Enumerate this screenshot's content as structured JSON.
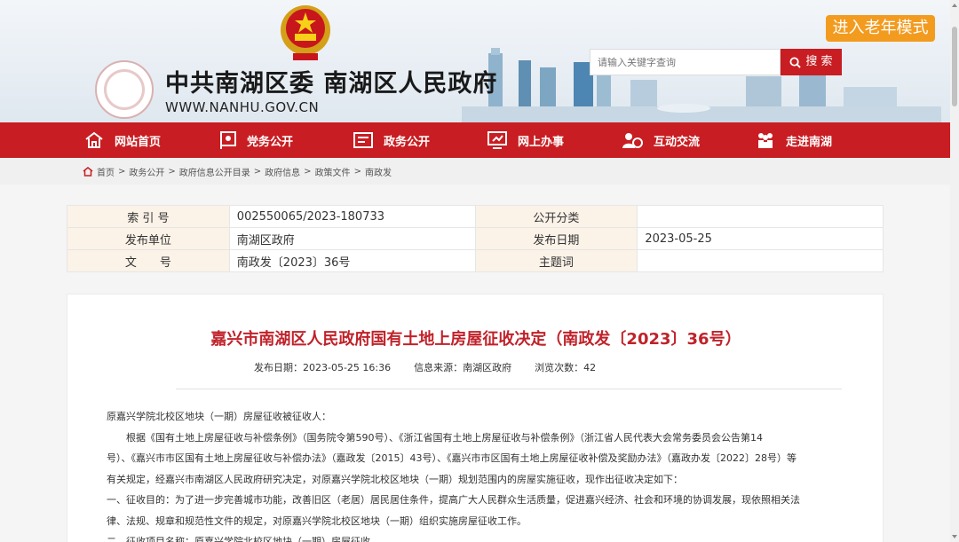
{
  "header": {
    "site_title": "中共南湖区委 南湖区人民政府",
    "site_url": "WWW.NANHU.GOV.CN",
    "elder_mode": "进入老年模式",
    "search_placeholder": "请输入关键字查询",
    "search_label": "搜 索"
  },
  "nav": {
    "items": [
      {
        "label": "网站首页",
        "icon": "home-icon"
      },
      {
        "label": "党务公开",
        "icon": "party-flag-icon"
      },
      {
        "label": "政务公开",
        "icon": "document-icon"
      },
      {
        "label": "网上办事",
        "icon": "online-service-icon"
      },
      {
        "label": "互动交流",
        "icon": "interaction-icon"
      },
      {
        "label": "走进南湖",
        "icon": "people-icon"
      }
    ]
  },
  "breadcrumb": [
    "首页",
    "政务公开",
    "政府信息公开目录",
    "政府信息",
    "政策文件",
    "南政发"
  ],
  "meta": {
    "index_label": "索 引 号",
    "index_value": "002550065/2023-180733",
    "category_label": "公开分类",
    "category_value": "",
    "issuer_label": "发布单位",
    "issuer_value": "南湖区政府",
    "date_label": "发布日期",
    "date_value": "2023-05-25",
    "docno_label": "文　　号",
    "docno_value": "南政发〔2023〕36号",
    "topic_label": "主题词",
    "topic_value": ""
  },
  "article": {
    "title": "嘉兴市南湖区人民政府国有土地上房屋征收决定（南政发〔2023〕36号）",
    "publish_date": "发布日期：2023-05-25 16:36",
    "source": "信息来源：南湖区政府",
    "views": "浏览次数：42",
    "paragraphs": [
      "原嘉兴学院北校区地块（一期）房屋征收被征收人：",
      "　　根据《国有土地上房屋征收与补偿条例》（国务院令第590号）、《浙江省国有土地上房屋征收与补偿条例》（浙江省人民代表大会常务委员会公告第14",
      "号）、《嘉兴市市区国有土地上房屋征收与补偿办法》（嘉政发〔2015〕43号）、《嘉兴市市区国有土地上房屋征收补偿及奖励办法》（嘉政办发〔2022〕28号）等",
      "有关规定，经嘉兴市南湖区人民政府研究决定，对原嘉兴学院北校区地块（一期）规划范围内的房屋实施征收，现作出征收决定如下：",
      "一、征收目的：为了进一步完善城市功能，改善旧区（老居）居民居住条件，提高广大人民群众生活质量，促进嘉兴经济、社会和环境的协调发展，现依照相关法",
      "律、法规、规章和规范性文件的规定，对原嘉兴学院北校区地块（一期）组织实施房屋征收工作。",
      "二、征收项目名称：原嘉兴学院北校区地块（一期）房屋征收"
    ]
  },
  "colors": {
    "brand_red": "#c81d22",
    "title_red": "#c0222a",
    "elder_orange": "#f39b1f",
    "label_bg": "#fbf2e8"
  }
}
